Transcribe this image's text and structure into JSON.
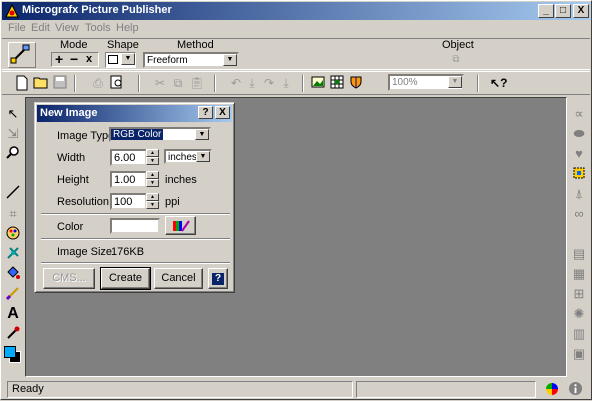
{
  "app": {
    "title": "Micrografx Picture Publisher",
    "min_label": "_",
    "max_label": "□",
    "close_label": "X"
  },
  "menu": {
    "file": "File",
    "edit": "Edit",
    "view": "View",
    "tools": "Tools",
    "help": "Help"
  },
  "context": {
    "mode_label": "Mode",
    "shape_label": "Shape",
    "method_label": "Method",
    "object_label": "Object",
    "method_value": "Freeform",
    "mode_plus": "+",
    "mode_minus": "−",
    "mode_x": "x"
  },
  "toolbar": {
    "zoom_value": "100%",
    "help_icon": "?"
  },
  "dialog": {
    "title": "New Image",
    "help_btn": "?",
    "close_btn": "X",
    "image_type_label": "Image Type",
    "image_type_value": "RGB Color",
    "width_label": "Width",
    "width_value": "6.00",
    "width_unit": "inches",
    "height_label": "Height",
    "height_value": "1.00",
    "height_unit": "inches",
    "resolution_label": "Resolution",
    "resolution_value": "100",
    "resolution_unit": "ppi",
    "color_label": "Color",
    "image_size_label": "Image Size",
    "image_size_value": "176KB",
    "cms_button": "CMS...",
    "create_button": "Create",
    "cancel_button": "Cancel",
    "help_button": "?"
  },
  "status": {
    "text": "Ready"
  },
  "colors": {
    "title_start": "#0a246a",
    "title_end": "#a6caf0",
    "workspace": "#808080",
    "face": "#d4d0c8"
  }
}
